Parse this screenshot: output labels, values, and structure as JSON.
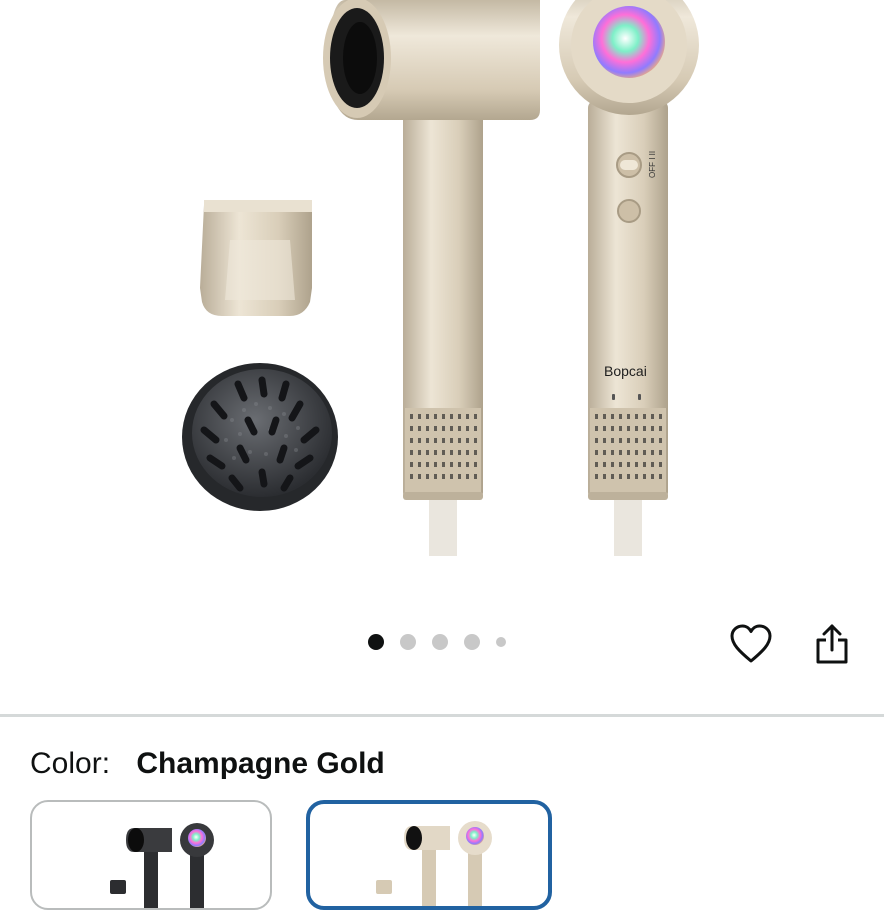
{
  "gallery": {
    "image_alt": "Bopcai hair dryer in Champagne Gold with concentrator and diffuser attachments",
    "brand_print": "Bopcai",
    "switch_print": "OFF I II",
    "dot_count": 5,
    "active_index": 0
  },
  "actions": {
    "favorite_icon": "heart-icon",
    "share_icon": "share-icon"
  },
  "variant": {
    "label": "Color:",
    "selected": "Champagne Gold",
    "swatches": [
      {
        "name": "Black",
        "selected": false
      },
      {
        "name": "Champagne Gold",
        "selected": true
      }
    ]
  },
  "colors": {
    "champagne": "#d8ccb6",
    "selected_border": "#2162a1",
    "divider": "#d5d9d9"
  }
}
